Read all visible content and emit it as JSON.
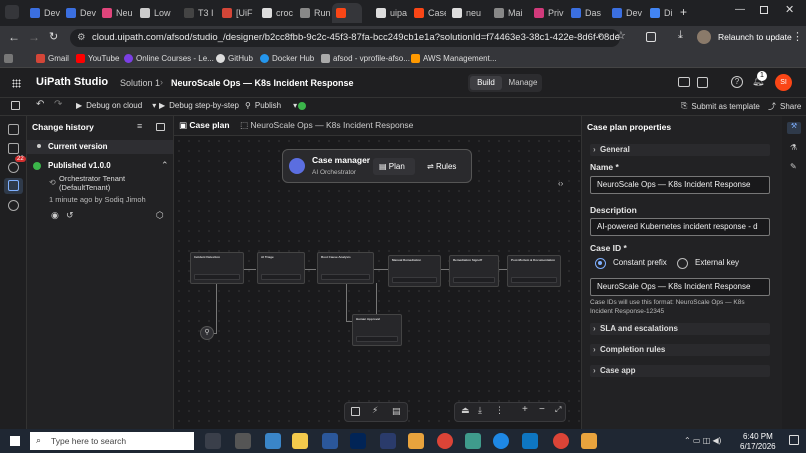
{
  "browser": {
    "tabs": [
      {
        "label": "Dev",
        "color": "#3b6fe0"
      },
      {
        "label": "Dev",
        "color": "#3b6fe0"
      },
      {
        "label": "Neu",
        "color": "#e0457b"
      },
      {
        "label": "Low",
        "color": "#cccccc"
      },
      {
        "label": "T3 I",
        "color": "#444444"
      },
      {
        "label": "[UiF",
        "color": "#d44638"
      },
      {
        "label": "croc",
        "color": "#dddddd"
      },
      {
        "label": "Run",
        "color": "#888888"
      },
      {
        "label": "",
        "color": "#fa4616"
      },
      {
        "label": "uipa",
        "color": "#dddddd"
      },
      {
        "label": "Case",
        "color": "#fa4616"
      },
      {
        "label": "neu",
        "color": "#dddddd"
      },
      {
        "label": "Mai",
        "color": "#888888"
      },
      {
        "label": "Priv",
        "color": "#d13a7b"
      },
      {
        "label": "Das",
        "color": "#3b6fe0"
      },
      {
        "label": "Dev",
        "color": "#3b6fe0"
      },
      {
        "label": "Di",
        "color": "#4285f4"
      }
    ],
    "url": "cloud.uipath.com/afsod/studio_/designer/b2cc8fbb-9c2c-45f3-87fa-bcc249cb1e1a?solutionId=f74463e3-38c1-422e-8d6f-08decc8606f...",
    "relaunch": "Relaunch to update",
    "bookmarks": [
      "Gmail",
      "YouTube",
      "Online Courses - Le...",
      "GitHub",
      "Docker Hub",
      "afsod - vprofile-afso...",
      "AWS Management..."
    ]
  },
  "app": {
    "logo": "UiPath Studio",
    "breadcrumb_solution": "Solution 1",
    "breadcrumb_project": "NeuroScale Ops — K8s Incident Response",
    "mode_build": "Build",
    "mode_manage": "Manage",
    "notif_count": "1",
    "avatar": "SI"
  },
  "toolbar": {
    "debug_cloud": "Debug on cloud",
    "debug_step": "Debug step-by-step",
    "publish": "Publish",
    "submit_template": "Submit as template",
    "share": "Share"
  },
  "history": {
    "title": "Change history",
    "current": "Current version",
    "published": "Published v1.0.0",
    "tenant": "Orchestrator Tenant (DefaultTenant)",
    "time": "1 minute ago by Sodiq Jimoh"
  },
  "canvas": {
    "tab_case_plan": "Case plan",
    "tab_project": "NeuroScale Ops — K8s Incident Response",
    "manager_title": "Case manager",
    "manager_sub": "AI Orchestrator",
    "plan_btn": "Plan",
    "rules_btn": "Rules",
    "nodes": [
      "Incident Detection",
      "AI Triage",
      "Root Cause Analysis",
      "Manual Remediation",
      "Remediation Signoff",
      "Post-Mortem & Documentation",
      "Human Approval"
    ]
  },
  "props": {
    "title": "Case plan properties",
    "general": "General",
    "name_label": "Name *",
    "name_value": "NeuroScale Ops — K8s Incident Response",
    "desc_label": "Description",
    "desc_value": "AI-powered Kubernetes incident response - d",
    "caseid_label": "Case ID *",
    "opt_prefix": "Constant prefix",
    "opt_external": "External key",
    "prefix_value": "NeuroScale Ops — K8s Incident Response",
    "caseid_hint": "Case IDs will use this format: NeuroScale Ops — K8s Incident Response-12345",
    "sla": "SLA and escalations",
    "completion": "Completion rules",
    "caseapp": "Case app"
  },
  "taskbar": {
    "search": "Type here to search",
    "time": "6:40 PM",
    "date": "6/17/2026"
  }
}
